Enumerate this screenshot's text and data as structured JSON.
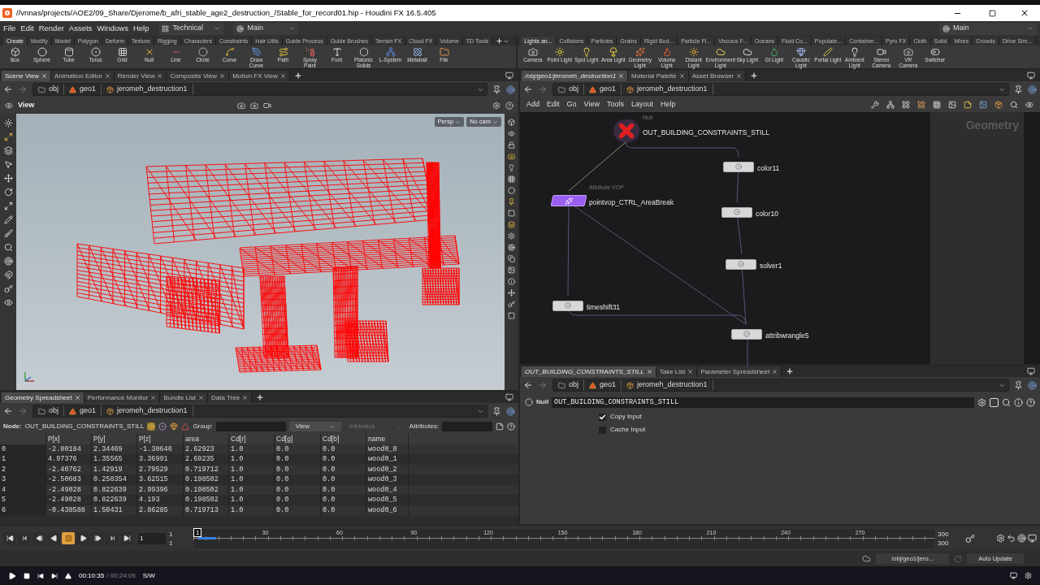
{
  "window": {
    "title": "//vnnas/projects/AOE2/09_Share/Djerome/b_afri_stable_age2_destruction_/Stable_for_record01.hip - Houdini FX 16.5.405"
  },
  "menu": [
    "File",
    "Edit",
    "Render",
    "Assets",
    "Windows",
    "Help"
  ],
  "desktops": [
    "Technical",
    "Main"
  ],
  "right_desktop": "Main",
  "shelf_left": {
    "tabs": [
      {
        "label": "Create",
        "selected": true
      },
      {
        "label": "Modify",
        "selected": false
      },
      {
        "label": "Model",
        "selected": false
      },
      {
        "label": "Polygon",
        "selected": false
      },
      {
        "label": "Deform",
        "selected": false
      },
      {
        "label": "Texture",
        "selected": false
      },
      {
        "label": "Rigging",
        "selected": false
      },
      {
        "label": "Characters",
        "selected": false
      },
      {
        "label": "Constraints",
        "selected": false
      },
      {
        "label": "Hair Utils",
        "selected": false
      },
      {
        "label": "Guide Process",
        "selected": false
      },
      {
        "label": "Guide Brushes",
        "selected": false
      },
      {
        "label": "Terrain FX",
        "selected": false
      },
      {
        "label": "Cloud FX",
        "selected": false
      },
      {
        "label": "Volume",
        "selected": false
      },
      {
        "label": "TD Tools",
        "selected": false
      }
    ],
    "tools": [
      "Box",
      "Sphere",
      "Tube",
      "Torus",
      "Grid",
      "Null",
      "Line",
      "Circle",
      "Curve",
      "Draw Curve",
      "Path",
      "Spray Paint",
      "Font",
      "Platonic Solids",
      "L-System",
      "Metaball",
      "File"
    ]
  },
  "shelf_right": {
    "tabs": [
      {
        "label": "Lights an...",
        "selected": true
      },
      {
        "label": "Collisions",
        "selected": false
      },
      {
        "label": "Particles",
        "selected": false
      },
      {
        "label": "Grains",
        "selected": false
      },
      {
        "label": "Rigid Bod...",
        "selected": false
      },
      {
        "label": "Particle Fl...",
        "selected": false
      },
      {
        "label": "Viscous F...",
        "selected": false
      },
      {
        "label": "Oceans",
        "selected": false
      },
      {
        "label": "Fluid Co...",
        "selected": false
      },
      {
        "label": "Populate...",
        "selected": false
      },
      {
        "label": "Container...",
        "selected": false
      },
      {
        "label": "Pyro FX",
        "selected": false
      },
      {
        "label": "Cloth",
        "selected": false
      },
      {
        "label": "Solid",
        "selected": false
      },
      {
        "label": "Wires",
        "selected": false
      },
      {
        "label": "Crowds",
        "selected": false
      },
      {
        "label": "Drive Sim...",
        "selected": false
      }
    ],
    "tools": [
      "Camera",
      "Point Light",
      "Spot Light",
      "Area Light",
      "Geometry Light",
      "Volume Light",
      "Distant Light",
      "Environment Light",
      "Sky Light",
      "GI Light",
      "Caustic Light",
      "Portal Light",
      "Ambient Light",
      "Stereo Camera",
      "VR Camera",
      "Switcher"
    ]
  },
  "scene_view": {
    "tabs": [
      {
        "label": "Scene View",
        "selected": true
      },
      {
        "label": "Animation Editor",
        "selected": false
      },
      {
        "label": "Render View",
        "selected": false
      },
      {
        "label": "Composite View",
        "selected": false
      },
      {
        "label": "Motion FX View",
        "selected": false
      }
    ],
    "path": [
      "obj",
      "geo1",
      "jeromeh_destruction1"
    ],
    "title": "View",
    "camera": [
      "Persp",
      "No cam"
    ]
  },
  "network": {
    "tabs": [
      {
        "label": "/obj/geo1/jeromeh_destruction1",
        "selected": true
      },
      {
        "label": "Material Palette",
        "selected": false
      },
      {
        "label": "Asset Browser",
        "selected": false
      }
    ],
    "path": [
      "obj",
      "geo1",
      "jeromeh_destruction1"
    ],
    "menu": [
      "Add",
      "Edit",
      "Go",
      "View",
      "Tools",
      "Layout",
      "Help"
    ],
    "context": "Geometry",
    "nodes": [
      {
        "kind": "null",
        "type_label": "Null",
        "name": "OUT_BUILDING_CONSTRAINTS_STILL"
      },
      {
        "kind": "sop",
        "name": "color11"
      },
      {
        "kind": "vop",
        "type_label": "Attribute VOP",
        "name": "pointvop_CTRL_AreaBreak"
      },
      {
        "kind": "sop",
        "name": "color10"
      },
      {
        "kind": "sop",
        "name": "solver1"
      },
      {
        "kind": "sop",
        "name": "timeshift31"
      },
      {
        "kind": "sop",
        "name": "attribwrangle5"
      }
    ]
  },
  "spreadsheet": {
    "tabs": [
      {
        "label": "Geometry Spreadsheet",
        "selected": true
      },
      {
        "label": "Performance Monitor",
        "selected": false
      },
      {
        "label": "Bundle List",
        "selected": false
      },
      {
        "label": "Data Tree",
        "selected": false
      }
    ],
    "path": [
      "obj",
      "geo1",
      "jeromeh_destruction1"
    ],
    "node_label": "Node:",
    "node": "OUT_BUILDING_CONSTRAINTS_STILL",
    "group_label": "Group:",
    "view": "View",
    "intrinsics": "Intrinsics",
    "attributes_label": "Attributes:",
    "columns": [
      "",
      "P[x]",
      "P[y]",
      "P[z]",
      "area",
      "Cd[r]",
      "Cd[g]",
      "Cd[b]",
      "name"
    ],
    "rows": [
      [
        "0",
        "-2.80184",
        "2.34469",
        "-1.30646",
        "2.62923",
        "1.0",
        "0.0",
        "0.0",
        "wood0_0"
      ],
      [
        "1",
        "4.97376",
        "1.35565",
        "3.36991",
        "2.69235",
        "1.0",
        "0.0",
        "0.0",
        "wood0_1"
      ],
      [
        "2",
        "-2.40762",
        "1.42919",
        "2.79529",
        "0.719712",
        "1.0",
        "0.0",
        "0.0",
        "wood0_2"
      ],
      [
        "3",
        "-2.50683",
        "0.258354",
        "3.62515",
        "0.198502",
        "1.0",
        "0.0",
        "0.0",
        "wood0_3"
      ],
      [
        "4",
        "-2.49028",
        "0.822639",
        "2.99396",
        "0.198502",
        "1.0",
        "0.0",
        "0.0",
        "wood0_4"
      ],
      [
        "5",
        "-2.49028",
        "0.822639",
        "4.193",
        "0.198502",
        "1.0",
        "0.0",
        "0.0",
        "wood0_5"
      ],
      [
        "6",
        "-0.438588",
        "1.50431",
        "2.86285",
        "0.719713",
        "1.0",
        "0.0",
        "0.0",
        "wood0_6"
      ]
    ]
  },
  "parameters": {
    "tabs": [
      {
        "label": "OUT_BUILDING_CONSTRAINTS_STILL",
        "selected": true
      },
      {
        "label": "Take List",
        "selected": false
      },
      {
        "label": "Parameter Spreadsheet",
        "selected": false
      }
    ],
    "path": [
      "obj",
      "geo1",
      "jeromeh_destruction1"
    ],
    "type": "Null",
    "name": "OUT_BUILDING_CONSTRAINTS_STILL",
    "toggles": [
      {
        "label": "Copy Input",
        "checked": true
      },
      {
        "label": "Cache Input",
        "checked": false
      }
    ]
  },
  "timeline": {
    "controls": [
      {
        "kind": "first",
        "selected": false
      },
      {
        "kind": "prev-key",
        "selected": false
      },
      {
        "kind": "step-back",
        "selected": false
      },
      {
        "kind": "reverse",
        "selected": false
      },
      {
        "kind": "stop",
        "selected": true
      },
      {
        "kind": "play",
        "selected": false
      },
      {
        "kind": "step-forward",
        "selected": false
      },
      {
        "kind": "next-key",
        "selected": false
      },
      {
        "kind": "last",
        "selected": false
      }
    ],
    "frame": "1",
    "start": [
      "1",
      "1"
    ],
    "playhead": "1",
    "ticks": [
      "30",
      "60",
      "90",
      "120",
      "150",
      "180",
      "210",
      "240",
      "270"
    ],
    "end": [
      "300",
      "300"
    ]
  },
  "status": {
    "path": "/obj/geo1/jero...",
    "update": "Auto Update"
  },
  "player": {
    "current": "00:10:35",
    "total": "/ 00:24:09",
    "mode": "S/W"
  }
}
